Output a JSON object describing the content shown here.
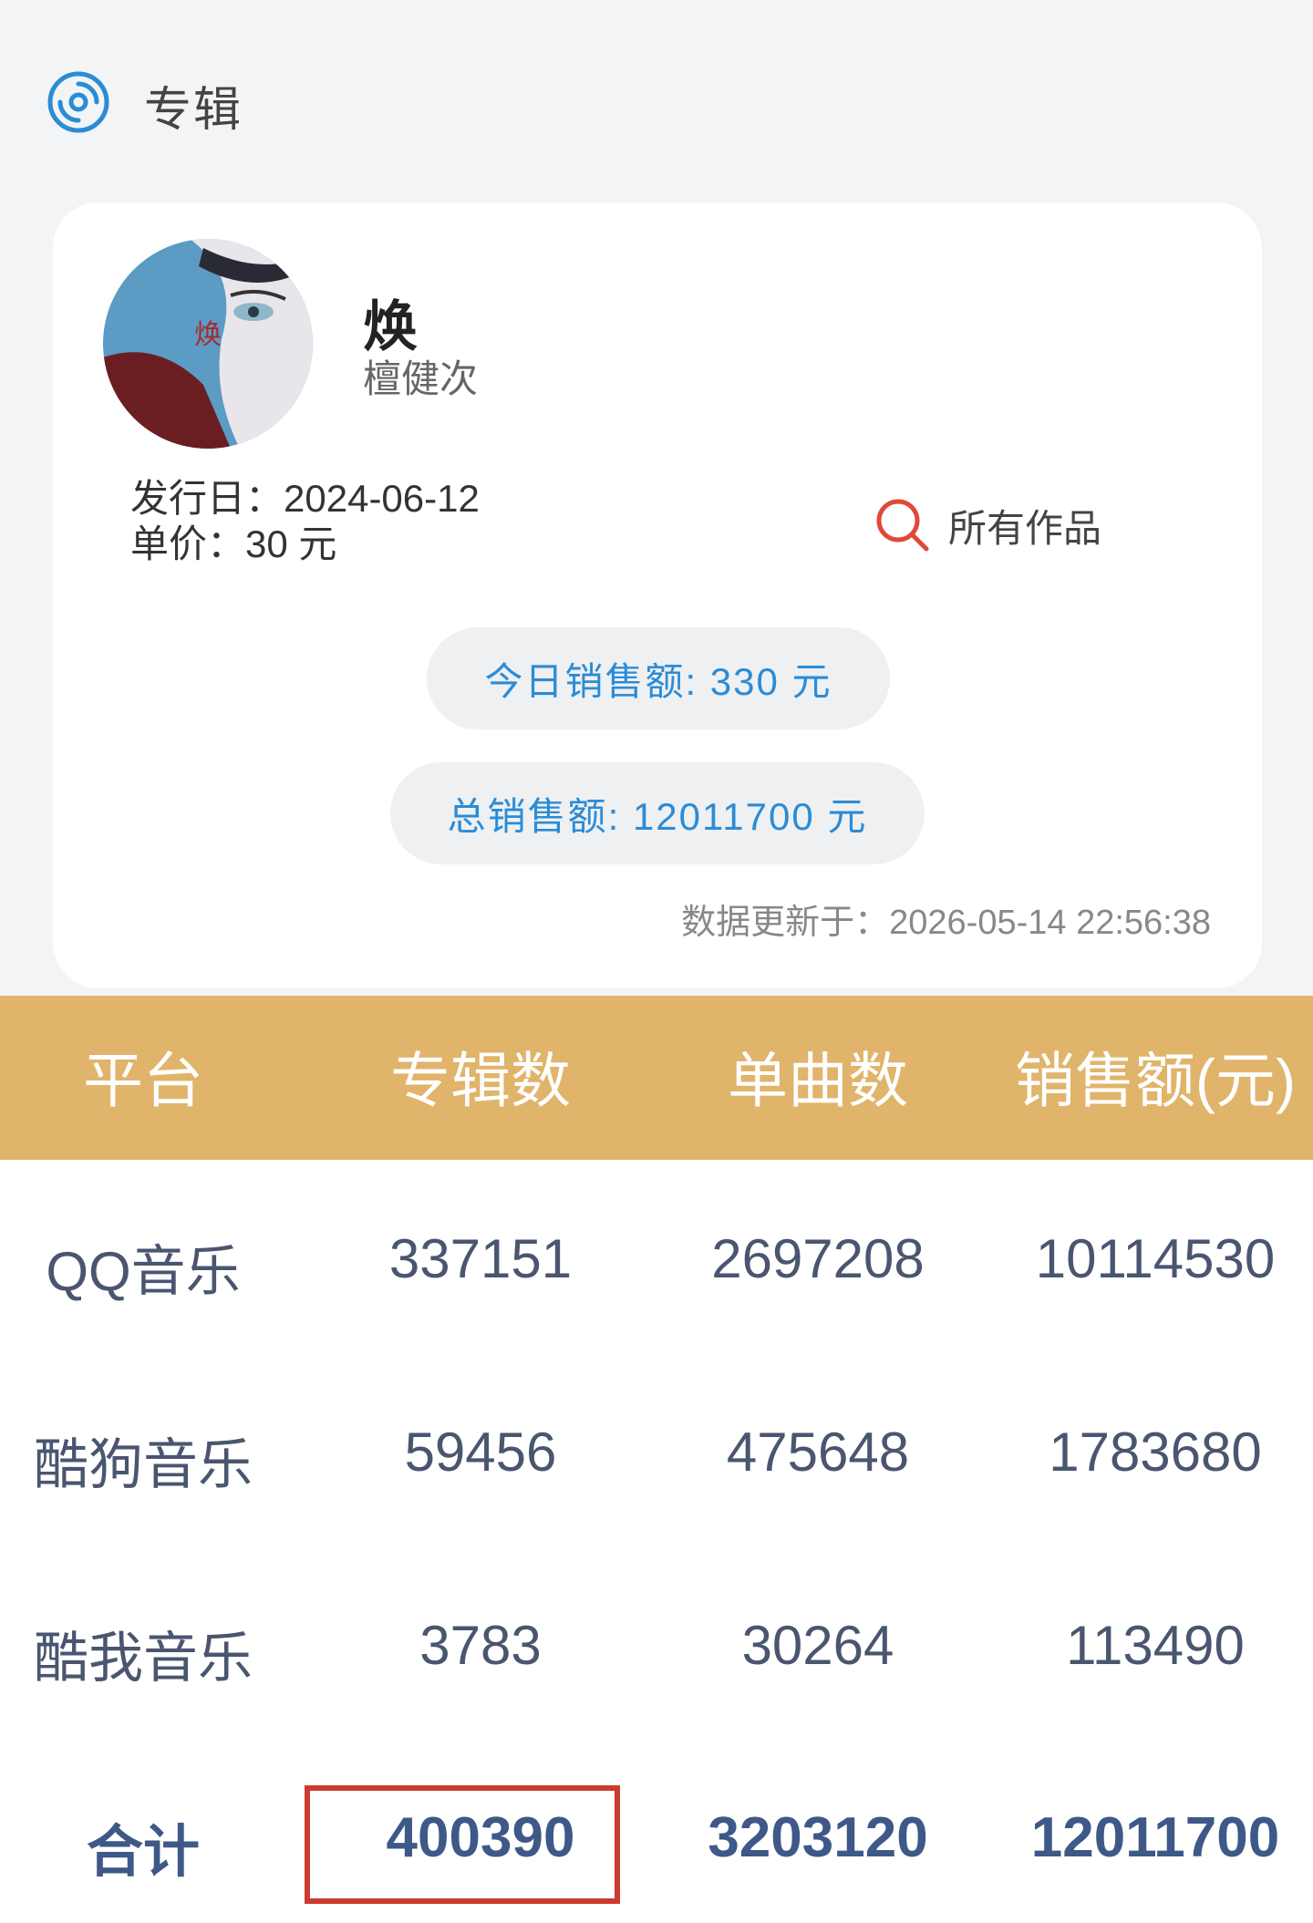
{
  "header": {
    "title": "专辑",
    "icon": "disc-icon"
  },
  "album": {
    "title": "焕",
    "artist": "檀健次",
    "release_label": "发行日：",
    "release_date": "2024-06-12",
    "price_label": "单价：",
    "price": "30 元",
    "all_works_label": "所有作品",
    "today_sales": "今日销售额: 330 元",
    "total_sales": "总销售额: 12011700 元",
    "updated": "数据更新于：2026-05-14 22:56:38"
  },
  "table": {
    "headers": [
      "平台",
      "专辑数",
      "单曲数",
      "销售额(元)"
    ],
    "rows": [
      [
        "QQ音乐",
        "337151",
        "2697208",
        "10114530"
      ],
      [
        "酷狗音乐",
        "59456",
        "475648",
        "1783680"
      ],
      [
        "酷我音乐",
        "3783",
        "30264",
        "113490"
      ]
    ],
    "total": [
      "合计",
      "400390",
      "3203120",
      "12011700"
    ]
  },
  "colors": {
    "accent_blue": "#2b8cd6",
    "header_gold": "#e0b46a",
    "highlight_red": "#cc3a30",
    "search_red": "#e0483c"
  }
}
